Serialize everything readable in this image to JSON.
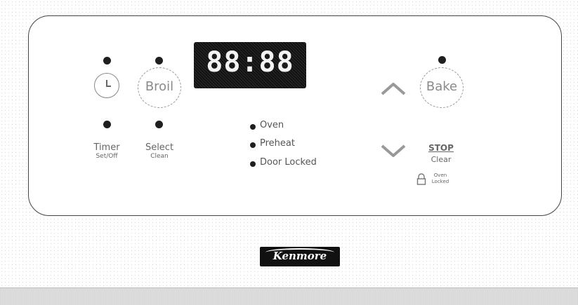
{
  "display": {
    "time": "88:88"
  },
  "buttons": {
    "broil": "Broil",
    "bake": "Bake"
  },
  "labels": {
    "timer": "Timer",
    "timer_sub": "Set/Off",
    "select": "Select",
    "select_sub": "Clean",
    "stop": "STOP",
    "stop_sub": "Clear",
    "oven_locked_top": "Oven",
    "oven_locked_bottom": "Locked"
  },
  "indicators": [
    "Oven",
    "Preheat",
    "Door Locked"
  ],
  "icons": {
    "timer": "clock-icon",
    "up": "up-arrow-icon",
    "down": "down-arrow-icon",
    "lock": "lock-icon"
  },
  "brand": {
    "name": "Kenmore"
  },
  "colors": {
    "display_bg": "#111111",
    "display_text": "#f3f3f3",
    "dot": "#1f1f1f"
  }
}
